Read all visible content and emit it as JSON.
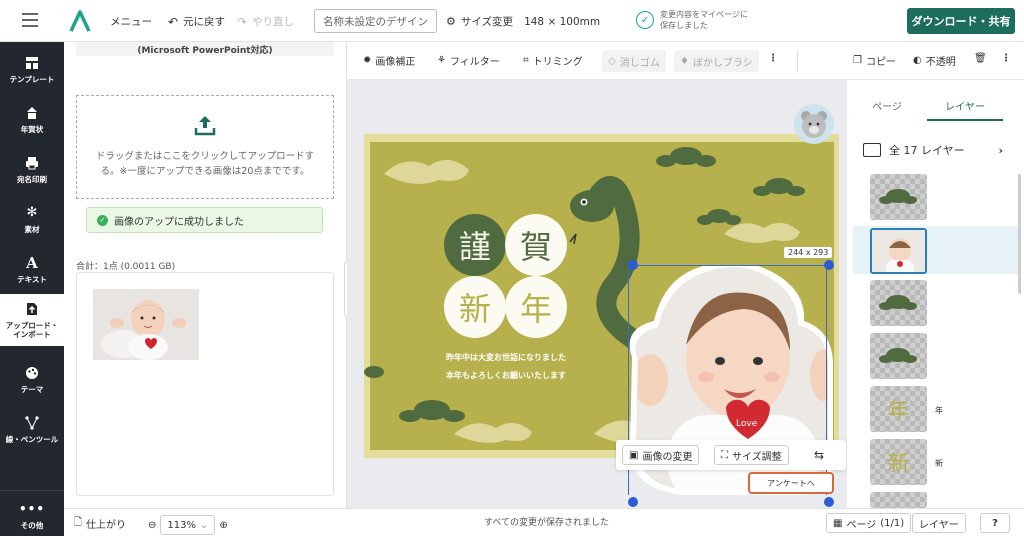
{
  "topbar": {
    "menu_label": "メニュー",
    "undo_label": "元に戻す",
    "redo_label": "やり直し",
    "design_name": "名称未設定のデザイン",
    "size_change_label": "サイズ変更",
    "size_value": "148 × 100mm",
    "save_status_line1": "変更内容をマイページに",
    "save_status_line2": "保存しました",
    "download_label": "ダウンロード・共有"
  },
  "sidebar": {
    "items": [
      {
        "label": "テンプレート",
        "icon": "template-icon"
      },
      {
        "label": "年賀状",
        "icon": "newyear-icon"
      },
      {
        "label": "宛名印刷",
        "icon": "printer-icon"
      },
      {
        "label": "素材",
        "icon": "material-icon"
      },
      {
        "label": "テキスト",
        "icon": "text-icon"
      },
      {
        "label": "アップロード・インポート",
        "icon": "upload-icon"
      },
      {
        "label": "テーマ",
        "icon": "palette-icon"
      },
      {
        "label": "線・ペンツール",
        "icon": "pen-tool-icon"
      },
      {
        "label": "その他",
        "icon": "more-icon"
      }
    ]
  },
  "panel": {
    "top_label": "(Microsoft PowerPoint対応)",
    "upload_text": "ドラッグまたはここをクリックしてアップロードする。※一度にアップできる画像は20点までです。",
    "success_text": "画像のアップに成功しました",
    "total_text": "合計：1点 (0.0011 GB)"
  },
  "toolbar": {
    "image_adjust": "画像補正",
    "filter": "フィルター",
    "trimming": "トリミング",
    "eraser": "消しゴム",
    "blur_brush": "ぼかしブラシ",
    "copy": "コピー",
    "opacity": "不透明"
  },
  "card": {
    "char1": "謹",
    "char2": "賀",
    "char3": "新",
    "char4": "年",
    "line1": "昨年中は大変お世話になりました",
    "line2": "本年もよろしくお願いいたします",
    "size_tag": "244 x 293",
    "heart_text": "Love",
    "change_image": "画像の変更",
    "size_adjust": "サイズ調整",
    "survey": "アンケートへ"
  },
  "right_panel": {
    "tab_page": "ページ",
    "tab_layer": "レイヤー",
    "layer_count": "全 17 レイヤー",
    "layers": [
      {
        "label": ""
      },
      {
        "label": ""
      },
      {
        "label": ""
      },
      {
        "label": ""
      },
      {
        "label": "年"
      },
      {
        "label": "新"
      }
    ]
  },
  "bottombar": {
    "finish_label": "仕上がり",
    "zoom_value": "113%",
    "status_text": "すべての変更が保存されました",
    "page_label": "ページ",
    "page_count": "(1/1)",
    "layer_button": "レイヤー",
    "help": "?"
  },
  "colors": {
    "accent": "#1c6d5e",
    "card_bg": "#b6b14c",
    "dark_green": "#4f6b3f",
    "success_bg": "#eaf7e5"
  }
}
